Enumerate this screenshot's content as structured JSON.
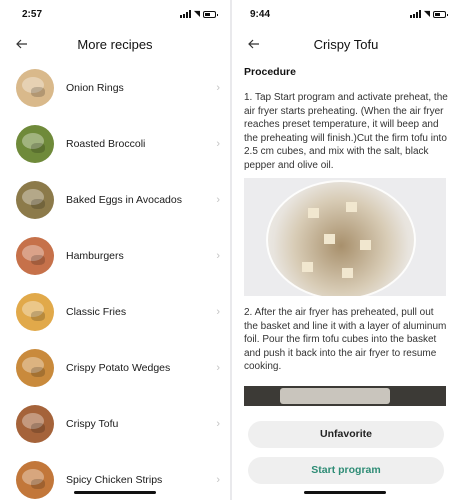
{
  "left": {
    "status": {
      "time": "2:57"
    },
    "header": {
      "title": "More recipes"
    },
    "recipes": [
      {
        "name": "Onion Rings",
        "color": "#d9b98b"
      },
      {
        "name": "Roasted Broccoli",
        "color": "#6f8a3a"
      },
      {
        "name": "Baked Eggs in Avocados",
        "color": "#8c7a4a"
      },
      {
        "name": "Hamburgers",
        "color": "#c6714a"
      },
      {
        "name": "Classic Fries",
        "color": "#e1a94a"
      },
      {
        "name": "Crispy Potato Wedges",
        "color": "#c98a3c"
      },
      {
        "name": "Crispy Tofu",
        "color": "#a5633a"
      },
      {
        "name": "Spicy Chicken Strips",
        "color": "#c2773a"
      }
    ]
  },
  "right": {
    "status": {
      "time": "9:44"
    },
    "header": {
      "title": "Crispy Tofu"
    },
    "section_title": "Procedure",
    "steps": [
      "1. Tap Start program and activate preheat, the air fryer starts preheating. (When the air fryer reaches preset temperature, it will beep and the preheating will finish.)Cut the firm tofu into 2.5 cm cubes, and mix with the salt, black pepper and olive oil.",
      "2. After the air fryer has preheated, pull out the basket and line it with a layer of aluminum foil. Pour the firm tofu cubes into the basket and push it back into the air fryer to resume cooking."
    ],
    "buttons": {
      "unfavorite": "Unfavorite",
      "start": "Start program"
    }
  },
  "colors": {
    "accent": "#2e8c75",
    "button_bg": "#efefef"
  }
}
